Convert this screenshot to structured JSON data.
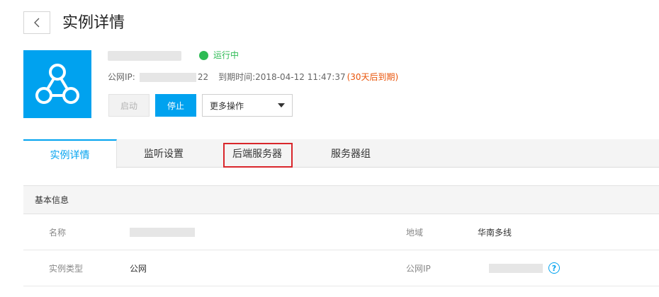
{
  "header": {
    "title": "实例详情"
  },
  "instance": {
    "status": "运行中",
    "status_color": "#2dbb54",
    "public_ip_label": "公网IP:",
    "public_ip_suffix": "22",
    "expire_label": "到期时间:",
    "expire_time": "2018-04-12 11:47:37",
    "expire_warning": "(30天后到期)"
  },
  "actions": {
    "start": "启动",
    "stop": "停止",
    "more": "更多操作"
  },
  "tabs": [
    {
      "label": "实例详情",
      "active": true
    },
    {
      "label": "监听设置",
      "active": false
    },
    {
      "label": "后端服务器",
      "active": false,
      "highlighted": true
    },
    {
      "label": "服务器组",
      "active": false
    }
  ],
  "info": {
    "section_title": "基本信息",
    "rows": [
      {
        "left_label": "名称",
        "right_label": "地域",
        "right_value": "华南多线"
      },
      {
        "left_label": "实例类型",
        "left_value": "公网",
        "right_label": "公网IP"
      }
    ]
  },
  "colors": {
    "accent": "#00a2ef",
    "warning": "#e9540a",
    "highlight_box": "#d9262b"
  }
}
